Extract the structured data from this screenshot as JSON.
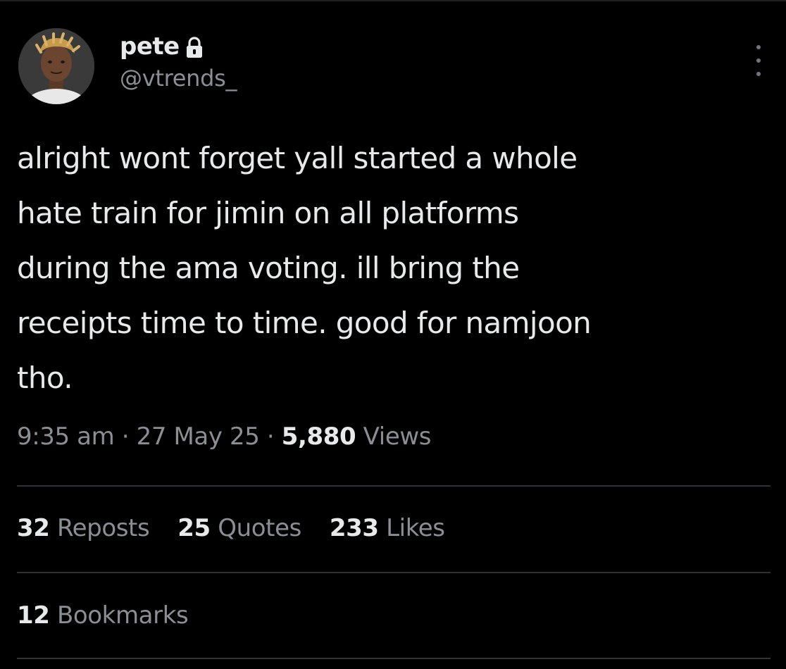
{
  "author": {
    "display_name": "pete",
    "handle": "@vtrends_",
    "protected_icon": "lock-icon",
    "avatar_icon": "profile-photo"
  },
  "menu": {
    "more_icon": "more-vertical-icon"
  },
  "tweet": {
    "text_lines": [
      "alright wont forget yall started a whole",
      "hate train for jimin on all platforms",
      "during the ama voting. ill bring the",
      "receipts time to time. good for namjoon",
      "tho."
    ]
  },
  "meta": {
    "time": "9:35 am",
    "separator": "·",
    "date": "27 May 25",
    "views_count": "5,880",
    "views_label": "Views"
  },
  "stats": {
    "reposts_count": "32",
    "reposts_label": "Reposts",
    "quotes_count": "25",
    "quotes_label": "Quotes",
    "likes_count": "233",
    "likes_label": "Likes",
    "bookmarks_count": "12",
    "bookmarks_label": "Bookmarks"
  },
  "colors": {
    "background": "#000000",
    "primary_text": "#e7e9ea",
    "secondary_text": "#8b8f94",
    "divider": "#2f3336"
  }
}
